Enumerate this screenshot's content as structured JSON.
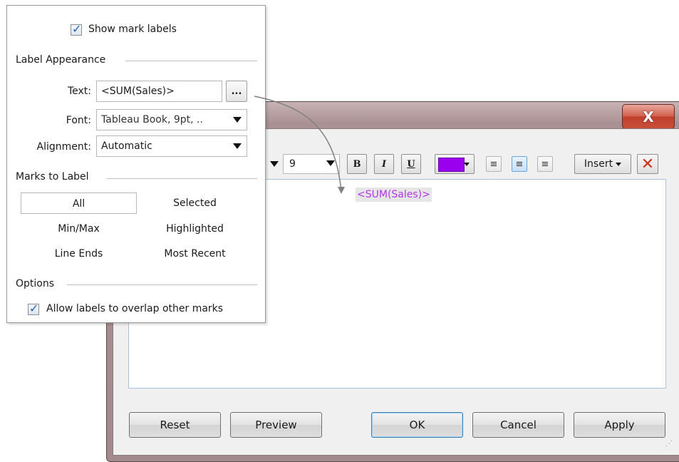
{
  "dialog": {
    "close_glyph": "X",
    "font_size_value": "9",
    "format_buttons": {
      "bold": "B",
      "italic": "I",
      "underline": "U"
    },
    "text_color": "#9a00ee",
    "alignment_icons": [
      "align-left-icon",
      "align-center-icon",
      "align-right-icon"
    ],
    "insert_label": "Insert",
    "editor_text": "<SUM(Sales)>",
    "buttons": {
      "reset": "Reset",
      "preview": "Preview",
      "ok": "OK",
      "cancel": "Cancel",
      "apply": "Apply"
    }
  },
  "panel": {
    "show_labels": {
      "label": "Show mark labels",
      "checked": true
    },
    "label_appearance": {
      "title": "Label Appearance",
      "text_label": "Text:",
      "text_value": "<SUM(Sales)>",
      "ellipsis": "...",
      "font_label": "Font:",
      "font_value": "Tableau Book, 9pt, ..",
      "alignment_label": "Alignment:",
      "alignment_value": "Automatic"
    },
    "marks_to_label": {
      "title": "Marks to Label",
      "options": [
        "All",
        "Selected",
        "Min/Max",
        "Highlighted",
        "Line Ends",
        "Most Recent"
      ],
      "selected": "All"
    },
    "options": {
      "title": "Options",
      "allow_overlap": {
        "label": "Allow labels to overlap other marks",
        "checked": true
      }
    }
  },
  "colors": {
    "label_text": "#b436e8",
    "close_button": "#c9503c",
    "accent_border": "#3c7fb1"
  }
}
